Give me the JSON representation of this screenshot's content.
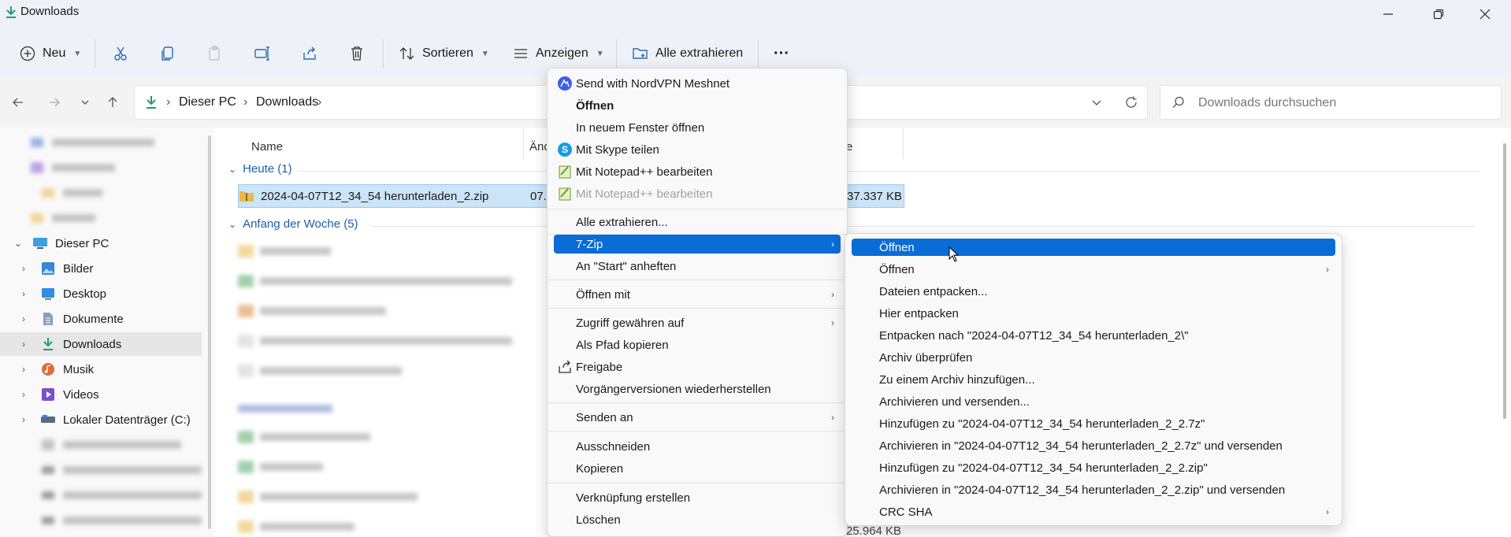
{
  "window": {
    "title": "Downloads",
    "controls": [
      "minimize",
      "maximize",
      "close"
    ]
  },
  "toolbar": {
    "new_label": "Neu",
    "sort_label": "Sortieren",
    "view_label": "Anzeigen",
    "extract_all_label": "Alle extrahieren",
    "more_label": "···"
  },
  "address": {
    "segments": [
      "Dieser PC",
      "Downloads"
    ],
    "search_placeholder": "Downloads durchsuchen"
  },
  "sidebar": {
    "items": [
      {
        "label": "Dieser PC",
        "icon": "pc-icon"
      },
      {
        "label": "Bilder",
        "icon": "pictures-icon"
      },
      {
        "label": "Desktop",
        "icon": "desktop-icon"
      },
      {
        "label": "Dokumente",
        "icon": "documents-icon"
      },
      {
        "label": "Downloads",
        "icon": "downloads-icon"
      },
      {
        "label": "Musik",
        "icon": "music-icon"
      },
      {
        "label": "Videos",
        "icon": "videos-icon"
      },
      {
        "label": "Lokaler Datenträger (C:)",
        "icon": "drive-icon"
      }
    ]
  },
  "content": {
    "columns": {
      "name": "Name",
      "date": "Änd",
      "size": "e"
    },
    "groups": {
      "today": "Heute (1)",
      "week": "Anfang der Woche (5)"
    },
    "selected_file": {
      "name": "2024-04-07T12_34_54 herunterladen_2.zip",
      "date": "07.0",
      "size": "37.337 KB"
    },
    "bottom_size": "25.964 KB"
  },
  "context_menu": {
    "items": [
      {
        "label": "Send with NordVPN Meshnet",
        "icon": "nordvpn-icon"
      },
      {
        "label": "Öffnen",
        "bold": true
      },
      {
        "label": "In neuem Fenster öffnen"
      },
      {
        "label": "Mit Skype teilen",
        "icon": "skype-icon"
      },
      {
        "label": "Mit Notepad++ bearbeiten",
        "icon": "notepadpp-icon"
      },
      {
        "label": "Mit Notepad++ bearbeiten",
        "icon": "notepadpp-icon",
        "disabled": true
      },
      {
        "label": "Alle extrahieren..."
      },
      {
        "label": "7-Zip",
        "submenu": true,
        "highlight": true
      },
      {
        "label": "An \"Start\" anheften"
      },
      {
        "label": "Öffnen mit",
        "submenu": true
      },
      {
        "label": "Zugriff gewähren auf",
        "submenu": true
      },
      {
        "label": "Als Pfad kopieren"
      },
      {
        "label": "Freigabe",
        "icon": "share-icon"
      },
      {
        "label": "Vorgängerversionen wiederherstellen"
      },
      {
        "label": "Senden an",
        "submenu": true
      },
      {
        "label": "Ausschneiden"
      },
      {
        "label": "Kopieren"
      },
      {
        "label": "Verknüpfung erstellen"
      },
      {
        "label": "Löschen"
      }
    ]
  },
  "zip_submenu": {
    "items": [
      {
        "label": "Öffnen",
        "highlight": true
      },
      {
        "label": "Öffnen",
        "submenu": true
      },
      {
        "label": "Dateien entpacken..."
      },
      {
        "label": "Hier entpacken"
      },
      {
        "label": "Entpacken nach \"2024-04-07T12_34_54 herunterladen_2\\\""
      },
      {
        "label": "Archiv überprüfen"
      },
      {
        "label": "Zu einem Archiv hinzufügen..."
      },
      {
        "label": "Archivieren und versenden..."
      },
      {
        "label": "Hinzufügen zu \"2024-04-07T12_34_54 herunterladen_2_2.7z\""
      },
      {
        "label": "Archivieren in \"2024-04-07T12_34_54 herunterladen_2_2.7z\" und versenden"
      },
      {
        "label": "Hinzufügen zu \"2024-04-07T12_34_54 herunterladen_2_2.zip\""
      },
      {
        "label": "Archivieren in \"2024-04-07T12_34_54 herunterladen_2_2.zip\" und versenden"
      },
      {
        "label": "CRC SHA",
        "submenu": true
      }
    ]
  },
  "colors": {
    "accent": "#0a6cd6",
    "selection": "#cce4f7",
    "group_text": "#1f5fa8"
  }
}
